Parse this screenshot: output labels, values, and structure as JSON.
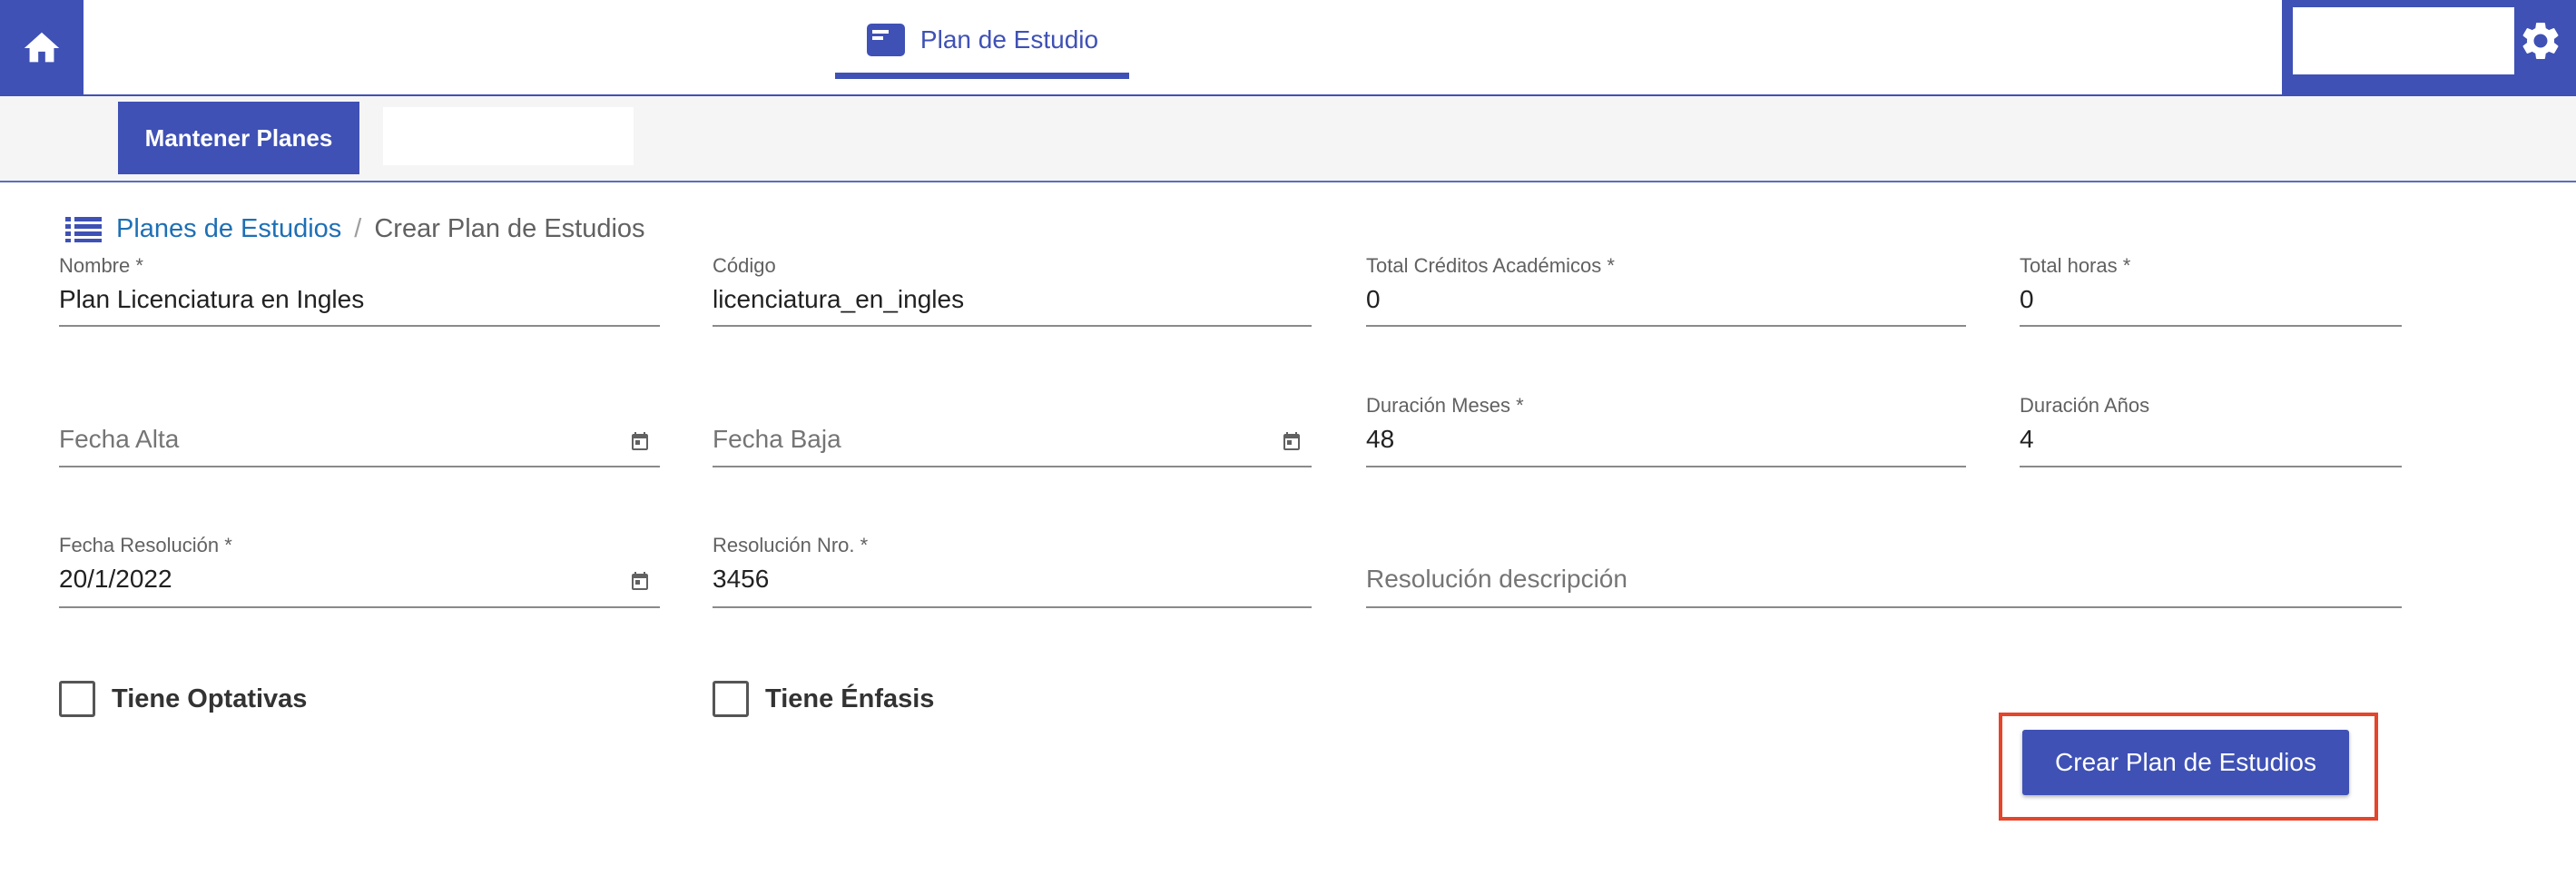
{
  "header": {
    "nav_tab_label": "Plan de Estudio",
    "accent_color": "#3f51b5",
    "icons": {
      "home": "home-icon",
      "tab": "document-icon",
      "settings": "gear-icon"
    }
  },
  "subnav": {
    "button_label": "Mantener Planes"
  },
  "breadcrumb": {
    "link": "Planes de Estudios",
    "separator": "/",
    "current": "Crear Plan de Estudios"
  },
  "form": {
    "nombre": {
      "label": "Nombre *",
      "value": "Plan Licenciatura en Ingles"
    },
    "codigo": {
      "label": "Código",
      "value": "licenciatura_en_ingles"
    },
    "total_creditos": {
      "label": "Total Créditos Académicos *",
      "value": "0"
    },
    "total_horas": {
      "label": "Total horas *",
      "value": "0"
    },
    "fecha_alta": {
      "placeholder": "Fecha Alta"
    },
    "fecha_baja": {
      "placeholder": "Fecha Baja"
    },
    "duracion_meses": {
      "label": "Duración Meses *",
      "value": "48"
    },
    "duracion_anios": {
      "label": "Duración Años",
      "value": "4"
    },
    "fecha_resolucion": {
      "label": "Fecha Resolución *",
      "value": "20/1/2022"
    },
    "resolucion_nro": {
      "label": "Resolución Nro. *",
      "value": "3456"
    },
    "resolucion_desc": {
      "placeholder": "Resolución descripción"
    },
    "tiene_optativas": {
      "label": "Tiene Optativas",
      "checked": false
    },
    "tiene_enfasis": {
      "label": "Tiene Énfasis",
      "checked": false
    }
  },
  "actions": {
    "submit_label": "Crear Plan de Estudios",
    "highlight_color": "#e4452b"
  }
}
